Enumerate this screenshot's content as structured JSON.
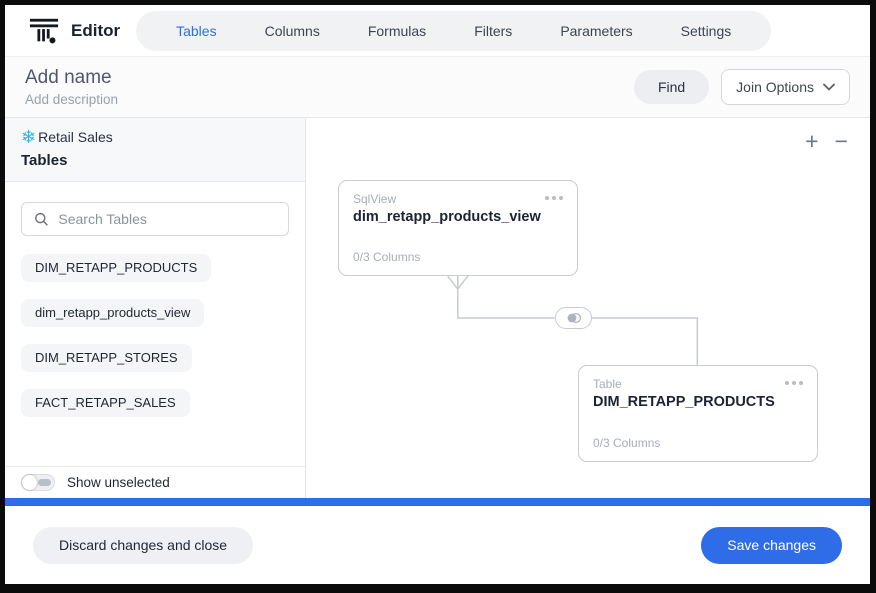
{
  "header": {
    "app_title": "Editor",
    "tabs": [
      {
        "label": "Tables",
        "active": true
      },
      {
        "label": "Columns",
        "active": false
      },
      {
        "label": "Formulas",
        "active": false
      },
      {
        "label": "Filters",
        "active": false
      },
      {
        "label": "Parameters",
        "active": false
      },
      {
        "label": "Settings",
        "active": false
      }
    ]
  },
  "toolbar": {
    "name_placeholder": "Add name",
    "description_placeholder": "Add description",
    "find_label": "Find",
    "join_options_label": "Join Options"
  },
  "sidebar": {
    "source_name": "Retail Sales",
    "source_icon": "snowflake-icon",
    "section_title": "Tables",
    "search_placeholder": "Search Tables",
    "tables": [
      "DIM_RETAPP_PRODUCTS",
      "dim_retapp_products_view",
      "DIM_RETAPP_STORES",
      "FACT_RETAPP_SALES"
    ],
    "show_unselected_label": "Show unselected",
    "show_unselected_on": false
  },
  "canvas": {
    "zoom_in_label": "+",
    "zoom_out_label": "−",
    "nodes": [
      {
        "type": "SqlView",
        "name": "dim_retapp_products_view",
        "columns": "0/3 Columns"
      },
      {
        "type": "Table",
        "name": "DIM_RETAPP_PRODUCTS",
        "columns": "0/3 Columns"
      }
    ],
    "join_icon": "venn-join-icon"
  },
  "footer": {
    "discard_label": "Discard changes and close",
    "save_label": "Save changes"
  },
  "colors": {
    "accent_blue": "#2e6ce8",
    "active_tab_blue": "#2b6fe4",
    "snowflake_cyan": "#29b5e8"
  }
}
